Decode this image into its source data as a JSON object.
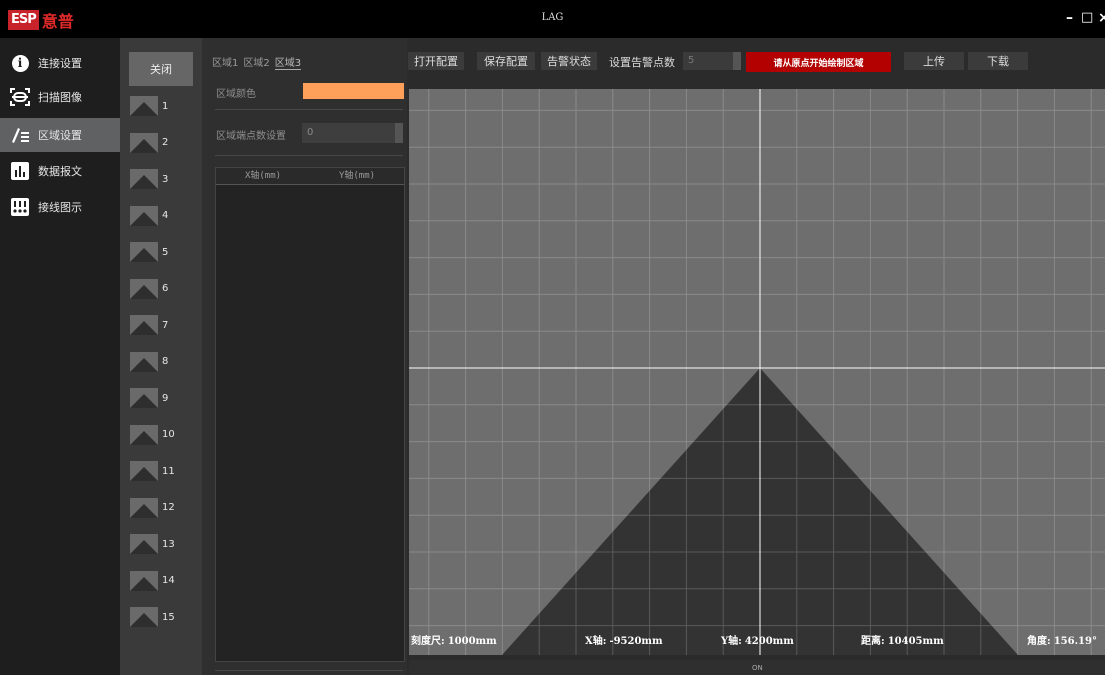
{
  "window": {
    "logo_badge": "ESP",
    "logo_text": "意普",
    "title": "LAG",
    "minimize": "–",
    "maximize": "□",
    "close": "×"
  },
  "nav": {
    "items": [
      {
        "label": "连接设置",
        "icon": "info-icon"
      },
      {
        "label": "扫描图像",
        "icon": "scan-icon"
      },
      {
        "label": "区域设置",
        "icon": "region-edit-icon",
        "active": true
      },
      {
        "label": "数据报文",
        "icon": "bar-chart-icon"
      },
      {
        "label": "接线图示",
        "icon": "wiring-icon"
      }
    ]
  },
  "zones": {
    "close_label": "关闭",
    "items": [
      "1",
      "2",
      "3",
      "4",
      "5",
      "6",
      "7",
      "8",
      "9",
      "10",
      "11",
      "12",
      "13",
      "14",
      "15"
    ]
  },
  "region_panel": {
    "tabs": [
      "区域1",
      "区域2",
      "区域3"
    ],
    "active_tab": 2,
    "color_label": "区域颜色",
    "color_value": "#ffa05a",
    "points_label": "区域端点数设置",
    "points_value": "0",
    "table_headers": [
      "X轴(mm)",
      "Y轴(mm)"
    ]
  },
  "toolbar": {
    "open_config": "打开配置",
    "save_config": "保存配置",
    "alarm_status": "告警状态",
    "alarm_points_label": "设置告警点数",
    "alarm_points_value": "5",
    "draw_hint": "请从原点开始绘制区域",
    "upload": "上传",
    "download": "下载"
  },
  "status": {
    "scale_label": "刻度尺:",
    "scale_value": "1000mm",
    "x_label": "X轴:",
    "x_value": "-9520mm",
    "y_label": "Y轴:",
    "y_value": "4200mm",
    "dist_label": "距离:",
    "dist_value": "10405mm",
    "angle_label": "角度:",
    "angle_value": "156.19°",
    "bottom_text": "ON"
  },
  "colors": {
    "grid_bg": "#6e6e6e",
    "grid_line": "#8a8a8a",
    "scan_area": "#333333",
    "accent_red": "#b30000",
    "region_color": "#ffa05a"
  }
}
